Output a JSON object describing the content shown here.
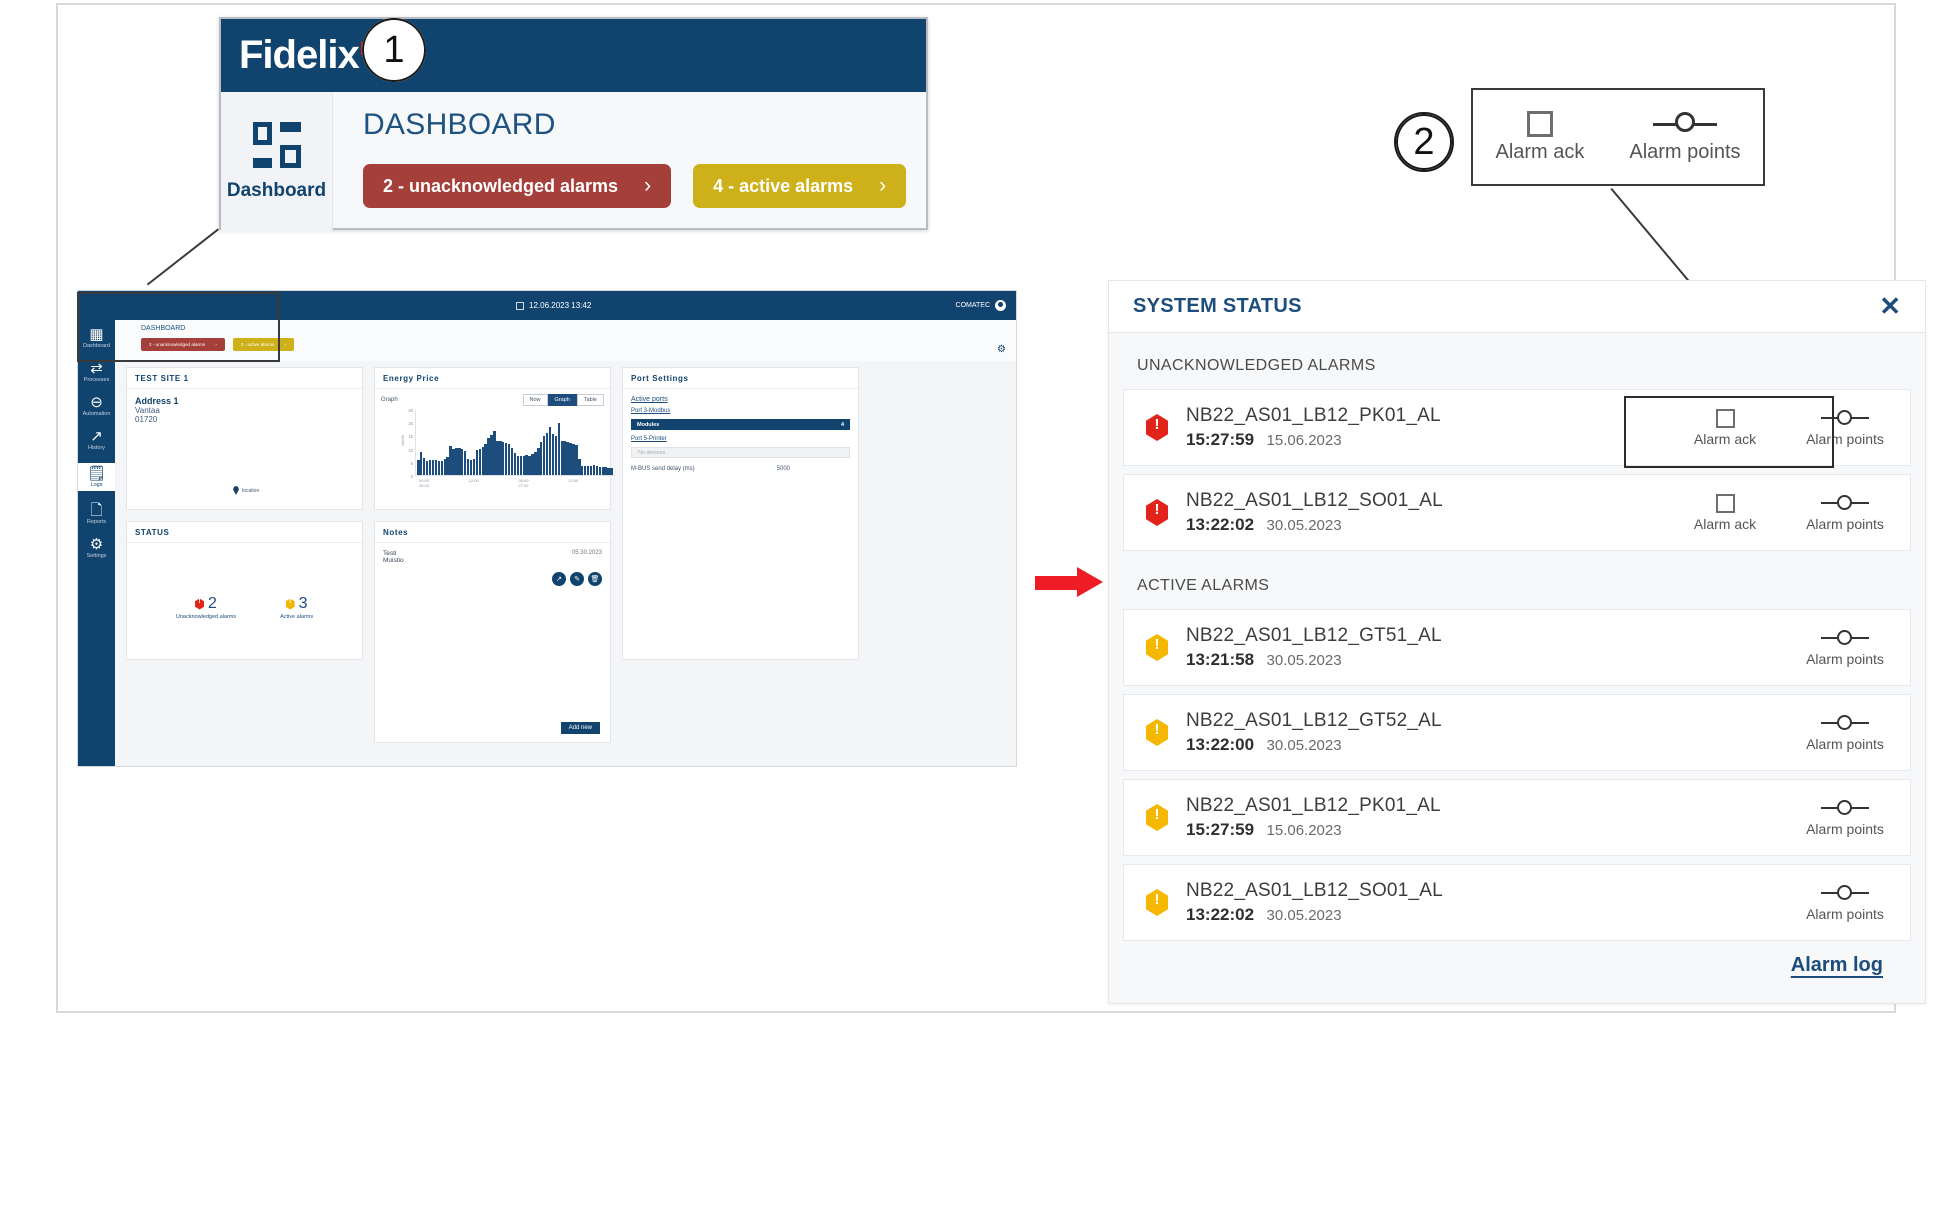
{
  "callout1": {
    "number": "1",
    "brand": "Fidelix",
    "nav_label": "Dashboard",
    "page_title": "DASHBOARD",
    "buttons": [
      {
        "label": "2 - unacknowledged alarms",
        "chevron": "›",
        "color": "#a53f3a"
      },
      {
        "label": "4 - active alarms",
        "chevron": "›",
        "color": "#cdb01a"
      }
    ]
  },
  "callout2": {
    "number": "2",
    "items": [
      {
        "icon": "checkbox-icon",
        "label": "Alarm ack"
      },
      {
        "icon": "alarm-points-icon",
        "label": "Alarm points"
      }
    ]
  },
  "mini_dashboard": {
    "topbar": {
      "datetime": "12.06.2023  13:42",
      "user": "COMATEC"
    },
    "sidebar": [
      {
        "label": "Dashboard",
        "icon": "grid-icon",
        "active": false
      },
      {
        "label": "Processes",
        "icon": "processes-icon",
        "active": false
      },
      {
        "label": "Automation",
        "icon": "automation-icon",
        "active": false
      },
      {
        "label": "History",
        "icon": "history-icon",
        "active": false
      },
      {
        "label": "Logs",
        "icon": "logs-icon",
        "active": true
      },
      {
        "label": "Reports",
        "icon": "reports-icon",
        "active": false
      },
      {
        "label": "Settings",
        "icon": "settings-icon",
        "active": false
      }
    ],
    "header": {
      "title": "DASHBOARD",
      "buttons": [
        {
          "label": "2 - unacknowledged alarms",
          "chevron": "›"
        },
        {
          "label": "3 - active alarms",
          "chevron": "›"
        }
      ]
    },
    "site_card": {
      "title": "TEST SITE 1",
      "address_line1": "Address 1",
      "address_line2": "Vantaa",
      "address_line3": "01720",
      "location_label": "location"
    },
    "status_card": {
      "title": "STATUS",
      "stats": [
        {
          "count": "2",
          "caption": "Unacknowledged alarms",
          "color": "#e2231a"
        },
        {
          "count": "3",
          "caption": "Active alarms",
          "color": "#f2b705"
        }
      ]
    },
    "energy_card": {
      "title": "Energy Price",
      "graph_label": "Graph",
      "segments": [
        {
          "label": "Now",
          "selected": false
        },
        {
          "label": "Graph",
          "selected": true
        },
        {
          "label": "Table",
          "selected": false
        }
      ]
    },
    "notes_card": {
      "title": "Notes",
      "note_title": "Testi",
      "note_body": "Muistio",
      "note_date": "05.30.2023",
      "buttons": [
        {
          "icon": "open-external-icon",
          "glyph": "↗"
        },
        {
          "icon": "edit-pencil-icon",
          "glyph": "✎"
        },
        {
          "icon": "delete-trash-icon",
          "glyph": "🗑"
        }
      ],
      "add_new_label": "Add new"
    },
    "port_card": {
      "title": "Port Settings",
      "active_ports_link": "Active ports",
      "port3_link": "Port 3-Modbus",
      "port3_value_name": "Modules",
      "port3_value_count": "4",
      "port5_link": "Port 5-Printer",
      "port5_placeholder": "No devices",
      "mbus_label": "M-BUS send delay (ms)",
      "mbus_value": "5000"
    }
  },
  "chart_data": {
    "type": "bar",
    "title": "Energy Price",
    "xlabel": "",
    "ylabel": "c/kWh",
    "ylim": [
      0,
      25
    ],
    "yticks": [
      0,
      5,
      10,
      15,
      20,
      25
    ],
    "xtick_labels": [
      "00:00\n26.02",
      "12:00",
      "00:00\n27.02",
      "12:00"
    ],
    "grid": false,
    "legend": "none",
    "values": [
      5.6,
      8.9,
      6.6,
      5.3,
      5.8,
      5.7,
      5.6,
      5.2,
      5.4,
      6.2,
      6.8,
      10.9,
      10.0,
      10.4,
      10.4,
      9.9,
      9.1,
      5.9,
      5.8,
      6.1,
      9.4,
      9.8,
      10.8,
      11.9,
      14.2,
      15.2,
      16.8,
      13.0,
      12.9,
      12.4,
      12.2,
      11.6,
      10.4,
      8.4,
      7.1,
      7.2,
      7.3,
      7.4,
      7.1,
      7.8,
      8.8,
      10.3,
      12.4,
      14.8,
      16.0,
      18.0,
      15.4,
      14.8,
      19.7,
      13.0,
      12.7,
      12.5,
      12.0,
      11.6,
      11.5,
      6.1,
      3.6,
      3.3,
      3.5,
      3.6,
      3.8,
      3.6,
      3.2,
      3.1,
      2.9,
      2.6,
      2.5
    ]
  },
  "system_status": {
    "title": "SYSTEM STATUS",
    "close_icon": "close-icon",
    "sections": [
      {
        "heading": "UNACKNOWLEDGED ALARMS",
        "rows": [
          {
            "severity": "red",
            "name": "NB22_AS01_LB12_PK01_AL",
            "time": "15:27:59",
            "date": "15.06.2023",
            "actions": [
              {
                "icon": "checkbox-icon",
                "label": "Alarm ack"
              },
              {
                "icon": "alarm-points-icon",
                "label": "Alarm points"
              }
            ]
          },
          {
            "severity": "red",
            "name": "NB22_AS01_LB12_SO01_AL",
            "time": "13:22:02",
            "date": "30.05.2023",
            "actions": [
              {
                "icon": "checkbox-icon",
                "label": "Alarm ack"
              },
              {
                "icon": "alarm-points-icon",
                "label": "Alarm points"
              }
            ]
          }
        ]
      },
      {
        "heading": "ACTIVE ALARMS",
        "rows": [
          {
            "severity": "yellow",
            "name": "NB22_AS01_LB12_GT51_AL",
            "time": "13:21:58",
            "date": "30.05.2023",
            "actions": [
              {
                "icon": "alarm-points-icon",
                "label": "Alarm points"
              }
            ]
          },
          {
            "severity": "yellow",
            "name": "NB22_AS01_LB12_GT52_AL",
            "time": "13:22:00",
            "date": "30.05.2023",
            "actions": [
              {
                "icon": "alarm-points-icon",
                "label": "Alarm points"
              }
            ]
          },
          {
            "severity": "yellow",
            "name": "NB22_AS01_LB12_PK01_AL",
            "time": "15:27:59",
            "date": "15.06.2023",
            "actions": [
              {
                "icon": "alarm-points-icon",
                "label": "Alarm points"
              }
            ]
          },
          {
            "severity": "yellow",
            "name": "NB22_AS01_LB12_SO01_AL",
            "time": "13:22:02",
            "date": "30.05.2023",
            "actions": [
              {
                "icon": "alarm-points-icon",
                "label": "Alarm points"
              }
            ]
          }
        ]
      }
    ],
    "alarm_log_link": "Alarm log"
  },
  "colors": {
    "brand_navy": "#10436e",
    "alarm_red": "#e2231a",
    "alarm_yellow": "#f5b700",
    "pill_red": "#a53f3a",
    "pill_yellow": "#cdb01a",
    "arrow_red": "#ee1c25"
  }
}
